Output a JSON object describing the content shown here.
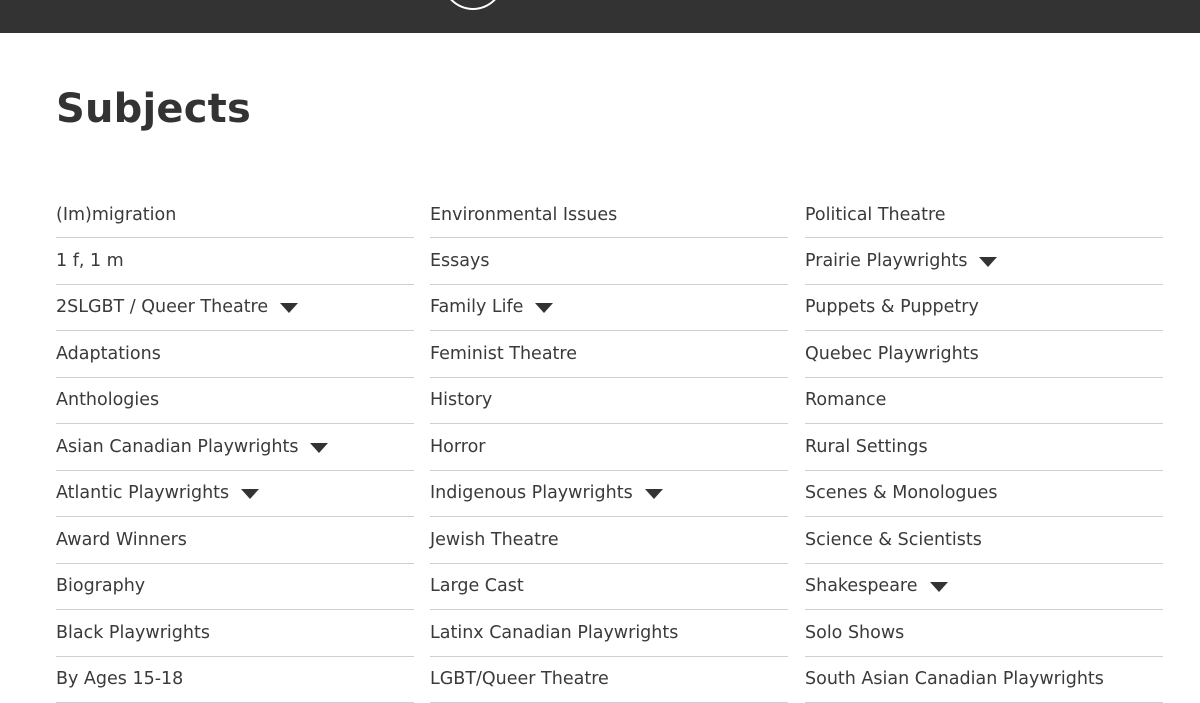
{
  "header": {
    "logo_icon": "logo-circle-icon"
  },
  "page": {
    "title": "Subjects"
  },
  "columns": [
    {
      "items": [
        {
          "label": "(Im)migration",
          "has_dropdown": false
        },
        {
          "label": "1 f, 1 m",
          "has_dropdown": false
        },
        {
          "label": "2SLGBT / Queer Theatre",
          "has_dropdown": true
        },
        {
          "label": "Adaptations",
          "has_dropdown": false
        },
        {
          "label": "Anthologies",
          "has_dropdown": false
        },
        {
          "label": "Asian Canadian Playwrights",
          "has_dropdown": true
        },
        {
          "label": "Atlantic Playwrights",
          "has_dropdown": true
        },
        {
          "label": "Award Winners",
          "has_dropdown": false
        },
        {
          "label": "Biography",
          "has_dropdown": false
        },
        {
          "label": "Black Playwrights",
          "has_dropdown": false
        },
        {
          "label": "By Ages 15-18",
          "has_dropdown": false
        }
      ]
    },
    {
      "items": [
        {
          "label": "Environmental Issues",
          "has_dropdown": false
        },
        {
          "label": "Essays",
          "has_dropdown": false
        },
        {
          "label": "Family Life",
          "has_dropdown": true
        },
        {
          "label": "Feminist Theatre",
          "has_dropdown": false
        },
        {
          "label": "History",
          "has_dropdown": false
        },
        {
          "label": "Horror",
          "has_dropdown": false
        },
        {
          "label": "Indigenous Playwrights",
          "has_dropdown": true
        },
        {
          "label": "Jewish Theatre",
          "has_dropdown": false
        },
        {
          "label": "Large Cast",
          "has_dropdown": false
        },
        {
          "label": "Latinx Canadian Playwrights",
          "has_dropdown": false
        },
        {
          "label": "LGBT/Queer Theatre",
          "has_dropdown": false
        }
      ]
    },
    {
      "items": [
        {
          "label": "Political Theatre",
          "has_dropdown": false
        },
        {
          "label": "Prairie Playwrights",
          "has_dropdown": true
        },
        {
          "label": "Puppets & Puppetry",
          "has_dropdown": false
        },
        {
          "label": "Quebec Playwrights",
          "has_dropdown": false
        },
        {
          "label": "Romance",
          "has_dropdown": false
        },
        {
          "label": "Rural Settings",
          "has_dropdown": false
        },
        {
          "label": "Scenes & Monologues",
          "has_dropdown": false
        },
        {
          "label": "Science & Scientists",
          "has_dropdown": false
        },
        {
          "label": "Shakespeare",
          "has_dropdown": true
        },
        {
          "label": "Solo Shows",
          "has_dropdown": false
        },
        {
          "label": "South Asian Canadian Playwrights",
          "has_dropdown": false
        }
      ]
    }
  ],
  "colors": {
    "topbar": "#333333",
    "text": "#3a3a3a",
    "divider": "#cfcfcf"
  }
}
